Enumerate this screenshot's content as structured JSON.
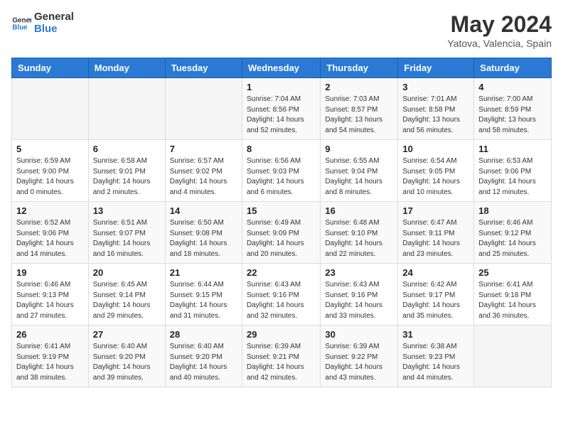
{
  "header": {
    "logo_general": "General",
    "logo_blue": "Blue",
    "month_year": "May 2024",
    "location": "Yatova, Valencia, Spain"
  },
  "weekdays": [
    "Sunday",
    "Monday",
    "Tuesday",
    "Wednesday",
    "Thursday",
    "Friday",
    "Saturday"
  ],
  "weeks": [
    [
      {
        "day": "",
        "sunrise": "",
        "sunset": "",
        "daylight": ""
      },
      {
        "day": "",
        "sunrise": "",
        "sunset": "",
        "daylight": ""
      },
      {
        "day": "",
        "sunrise": "",
        "sunset": "",
        "daylight": ""
      },
      {
        "day": "1",
        "sunrise": "Sunrise: 7:04 AM",
        "sunset": "Sunset: 8:56 PM",
        "daylight": "Daylight: 14 hours and 52 minutes."
      },
      {
        "day": "2",
        "sunrise": "Sunrise: 7:03 AM",
        "sunset": "Sunset: 8:57 PM",
        "daylight": "Daylight: 13 hours and 54 minutes."
      },
      {
        "day": "3",
        "sunrise": "Sunrise: 7:01 AM",
        "sunset": "Sunset: 8:58 PM",
        "daylight": "Daylight: 13 hours and 56 minutes."
      },
      {
        "day": "4",
        "sunrise": "Sunrise: 7:00 AM",
        "sunset": "Sunset: 8:59 PM",
        "daylight": "Daylight: 13 hours and 58 minutes."
      }
    ],
    [
      {
        "day": "5",
        "sunrise": "Sunrise: 6:59 AM",
        "sunset": "Sunset: 9:00 PM",
        "daylight": "Daylight: 14 hours and 0 minutes."
      },
      {
        "day": "6",
        "sunrise": "Sunrise: 6:58 AM",
        "sunset": "Sunset: 9:01 PM",
        "daylight": "Daylight: 14 hours and 2 minutes."
      },
      {
        "day": "7",
        "sunrise": "Sunrise: 6:57 AM",
        "sunset": "Sunset: 9:02 PM",
        "daylight": "Daylight: 14 hours and 4 minutes."
      },
      {
        "day": "8",
        "sunrise": "Sunrise: 6:56 AM",
        "sunset": "Sunset: 9:03 PM",
        "daylight": "Daylight: 14 hours and 6 minutes."
      },
      {
        "day": "9",
        "sunrise": "Sunrise: 6:55 AM",
        "sunset": "Sunset: 9:04 PM",
        "daylight": "Daylight: 14 hours and 8 minutes."
      },
      {
        "day": "10",
        "sunrise": "Sunrise: 6:54 AM",
        "sunset": "Sunset: 9:05 PM",
        "daylight": "Daylight: 14 hours and 10 minutes."
      },
      {
        "day": "11",
        "sunrise": "Sunrise: 6:53 AM",
        "sunset": "Sunset: 9:06 PM",
        "daylight": "Daylight: 14 hours and 12 minutes."
      }
    ],
    [
      {
        "day": "12",
        "sunrise": "Sunrise: 6:52 AM",
        "sunset": "Sunset: 9:06 PM",
        "daylight": "Daylight: 14 hours and 14 minutes."
      },
      {
        "day": "13",
        "sunrise": "Sunrise: 6:51 AM",
        "sunset": "Sunset: 9:07 PM",
        "daylight": "Daylight: 14 hours and 16 minutes."
      },
      {
        "day": "14",
        "sunrise": "Sunrise: 6:50 AM",
        "sunset": "Sunset: 9:08 PM",
        "daylight": "Daylight: 14 hours and 18 minutes."
      },
      {
        "day": "15",
        "sunrise": "Sunrise: 6:49 AM",
        "sunset": "Sunset: 9:09 PM",
        "daylight": "Daylight: 14 hours and 20 minutes."
      },
      {
        "day": "16",
        "sunrise": "Sunrise: 6:48 AM",
        "sunset": "Sunset: 9:10 PM",
        "daylight": "Daylight: 14 hours and 22 minutes."
      },
      {
        "day": "17",
        "sunrise": "Sunrise: 6:47 AM",
        "sunset": "Sunset: 9:11 PM",
        "daylight": "Daylight: 14 hours and 23 minutes."
      },
      {
        "day": "18",
        "sunrise": "Sunrise: 6:46 AM",
        "sunset": "Sunset: 9:12 PM",
        "daylight": "Daylight: 14 hours and 25 minutes."
      }
    ],
    [
      {
        "day": "19",
        "sunrise": "Sunrise: 6:46 AM",
        "sunset": "Sunset: 9:13 PM",
        "daylight": "Daylight: 14 hours and 27 minutes."
      },
      {
        "day": "20",
        "sunrise": "Sunrise: 6:45 AM",
        "sunset": "Sunset: 9:14 PM",
        "daylight": "Daylight: 14 hours and 29 minutes."
      },
      {
        "day": "21",
        "sunrise": "Sunrise: 6:44 AM",
        "sunset": "Sunset: 9:15 PM",
        "daylight": "Daylight: 14 hours and 31 minutes."
      },
      {
        "day": "22",
        "sunrise": "Sunrise: 6:43 AM",
        "sunset": "Sunset: 9:16 PM",
        "daylight": "Daylight: 14 hours and 32 minutes."
      },
      {
        "day": "23",
        "sunrise": "Sunrise: 6:43 AM",
        "sunset": "Sunset: 9:16 PM",
        "daylight": "Daylight: 14 hours and 33 minutes."
      },
      {
        "day": "24",
        "sunrise": "Sunrise: 6:42 AM",
        "sunset": "Sunset: 9:17 PM",
        "daylight": "Daylight: 14 hours and 35 minutes."
      },
      {
        "day": "25",
        "sunrise": "Sunrise: 6:41 AM",
        "sunset": "Sunset: 9:18 PM",
        "daylight": "Daylight: 14 hours and 36 minutes."
      }
    ],
    [
      {
        "day": "26",
        "sunrise": "Sunrise: 6:41 AM",
        "sunset": "Sunset: 9:19 PM",
        "daylight": "Daylight: 14 hours and 38 minutes."
      },
      {
        "day": "27",
        "sunrise": "Sunrise: 6:40 AM",
        "sunset": "Sunset: 9:20 PM",
        "daylight": "Daylight: 14 hours and 39 minutes."
      },
      {
        "day": "28",
        "sunrise": "Sunrise: 6:40 AM",
        "sunset": "Sunset: 9:20 PM",
        "daylight": "Daylight: 14 hours and 40 minutes."
      },
      {
        "day": "29",
        "sunrise": "Sunrise: 6:39 AM",
        "sunset": "Sunset: 9:21 PM",
        "daylight": "Daylight: 14 hours and 42 minutes."
      },
      {
        "day": "30",
        "sunrise": "Sunrise: 6:39 AM",
        "sunset": "Sunset: 9:22 PM",
        "daylight": "Daylight: 14 hours and 43 minutes."
      },
      {
        "day": "31",
        "sunrise": "Sunrise: 6:38 AM",
        "sunset": "Sunset: 9:23 PM",
        "daylight": "Daylight: 14 hours and 44 minutes."
      },
      {
        "day": "",
        "sunrise": "",
        "sunset": "",
        "daylight": ""
      }
    ]
  ]
}
